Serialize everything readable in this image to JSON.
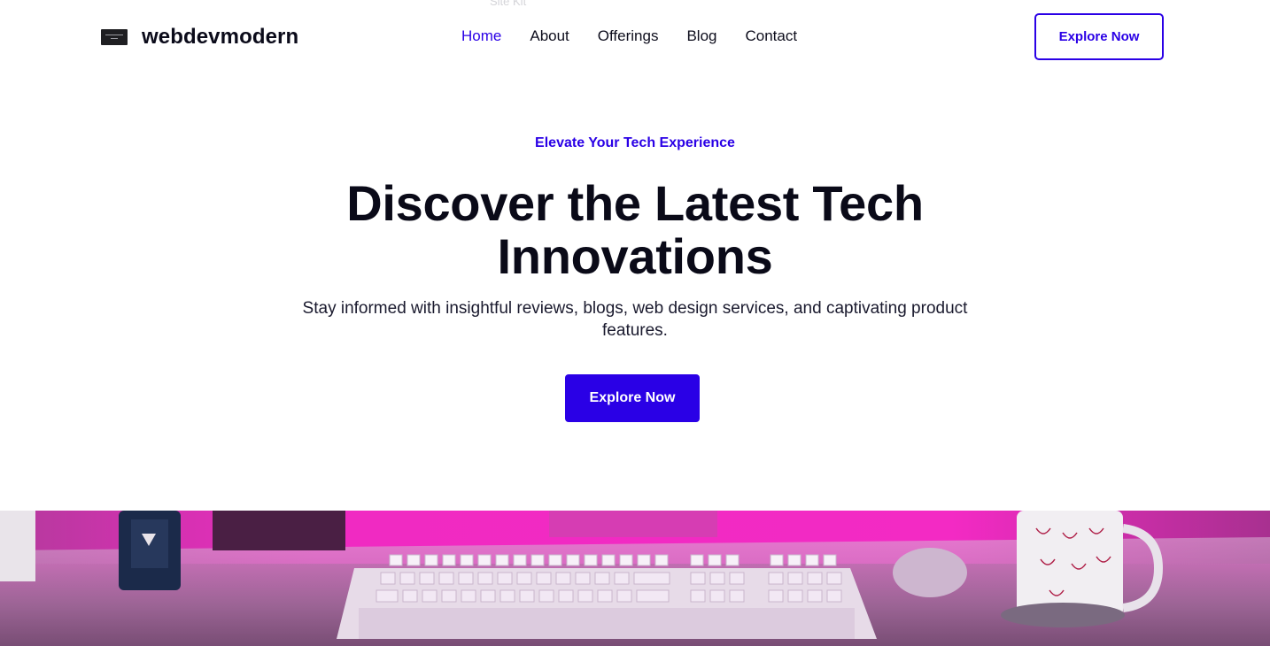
{
  "top_label": "Site Kit",
  "header": {
    "brand": "webdevmodern",
    "nav": [
      {
        "label": "Home",
        "active": true
      },
      {
        "label": "About",
        "active": false
      },
      {
        "label": "Offerings",
        "active": false
      },
      {
        "label": "Blog",
        "active": false
      },
      {
        "label": "Contact",
        "active": false
      }
    ],
    "cta_label": "Explore Now"
  },
  "hero": {
    "eyebrow": "Elevate Your Tech Experience",
    "headline_line1": "Discover the Latest Tech",
    "headline_line2": "Innovations",
    "subtext": "Stay informed with insightful reviews, blogs, web design services, and captivating product features.",
    "cta_label": "Explore Now"
  },
  "colors": {
    "accent": "#2a00e6",
    "text_dark": "#0a0a18",
    "background": "#ffffff",
    "image_tint": "#e22ab8"
  }
}
